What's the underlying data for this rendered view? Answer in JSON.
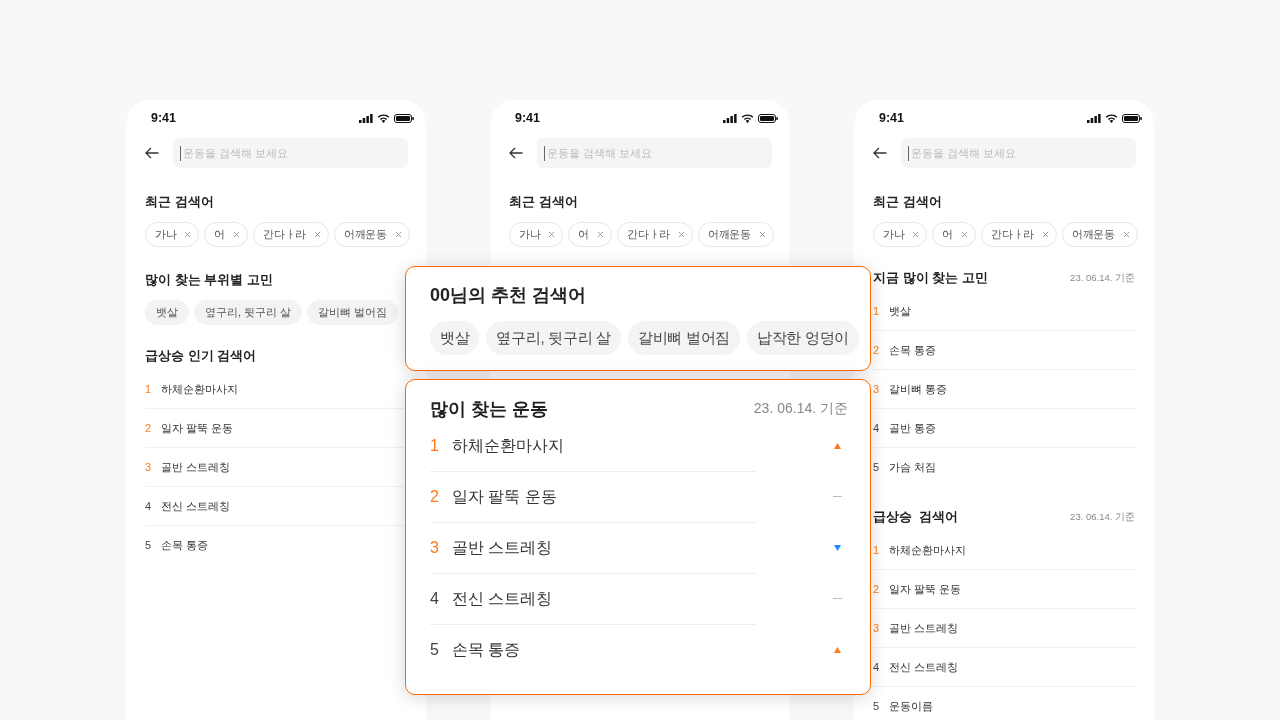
{
  "phones": [
    {
      "time": "9:41",
      "search_placeholder": "운동을 검색해 보세요",
      "recent": {
        "title": "최근 검색어",
        "chips": [
          "가나",
          "어",
          "간다ㅏ라",
          "어깨운동"
        ]
      },
      "sections": [
        {
          "kind": "chips",
          "title": "많이 찾는 부위별 고민",
          "chips": [
            "뱃살",
            "옆구리, 뒷구리 살",
            "갈비뼈 벌어짐"
          ]
        },
        {
          "kind": "ranked",
          "title": "급상승 인기 검색어",
          "items": [
            {
              "rank": "1",
              "label": "하체순환마사지",
              "highlighted": true
            },
            {
              "rank": "2",
              "label": "일자 팔뚝 운동",
              "highlighted": true
            },
            {
              "rank": "3",
              "label": "골반 스트레칭",
              "highlighted": true
            },
            {
              "rank": "4",
              "label": "전신 스트레칭",
              "highlighted": false
            },
            {
              "rank": "5",
              "label": "손목 통증",
              "highlighted": false
            }
          ]
        }
      ]
    },
    {
      "time": "9:41",
      "search_placeholder": "운동을 검색해 보세요",
      "recent": {
        "title": "최근 검색어",
        "chips": [
          "가나",
          "어",
          "간다ㅏ라",
          "어깨운동"
        ]
      }
    },
    {
      "time": "9:41",
      "search_placeholder": "운동을 검색해 보세요",
      "recent": {
        "title": "최근 검색어",
        "chips": [
          "가나",
          "어",
          "간다ㅏ라",
          "어깨운동"
        ]
      },
      "sections": [
        {
          "kind": "ranked",
          "title": "지금 많이 찾는 고민",
          "date": "23. 06.14. 기준",
          "items": [
            {
              "rank": "1",
              "label": "뱃살",
              "highlighted": true
            },
            {
              "rank": "2",
              "label": "손목 통증",
              "highlighted": true
            },
            {
              "rank": "3",
              "label": "갈비뼈 통증",
              "highlighted": true
            },
            {
              "rank": "4",
              "label": "골반 통증",
              "highlighted": false
            },
            {
              "rank": "5",
              "label": "가슴 처짐",
              "highlighted": false
            }
          ]
        },
        {
          "kind": "ranked",
          "title": "급상승  검색어",
          "date": "23. 06.14. 기준",
          "items": [
            {
              "rank": "1",
              "label": "하체순환마사지",
              "highlighted": true
            },
            {
              "rank": "2",
              "label": "일자 팔뚝 운동",
              "highlighted": true
            },
            {
              "rank": "3",
              "label": "골반 스트레칭",
              "highlighted": true
            },
            {
              "rank": "4",
              "label": "전신 스트레칭",
              "highlighted": false
            },
            {
              "rank": "5",
              "label": "운동이름",
              "highlighted": false
            }
          ]
        }
      ]
    }
  ],
  "callouts": [
    {
      "kind": "chips",
      "title": "00님의 추천 검색어",
      "chips": [
        "뱃살",
        "옆구리, 뒷구리 살",
        "갈비뼈 벌어짐",
        "납작한 엉덩이"
      ]
    },
    {
      "kind": "ranked",
      "title": "많이 찾는 운동",
      "date": "23. 06.14. 기준",
      "items": [
        {
          "rank": "1",
          "label": "하체순환마사지",
          "highlighted": true,
          "kind": "up"
        },
        {
          "rank": "2",
          "label": "일자 팔뚝 운동",
          "highlighted": true,
          "kind": "same"
        },
        {
          "rank": "3",
          "label": "골반 스트레칭",
          "highlighted": true,
          "kind": "down"
        },
        {
          "rank": "4",
          "label": "전신 스트레칭",
          "highlighted": false,
          "kind": "same"
        },
        {
          "rank": "5",
          "label": "손목 통증",
          "highlighted": false,
          "kind": "up"
        }
      ]
    }
  ]
}
